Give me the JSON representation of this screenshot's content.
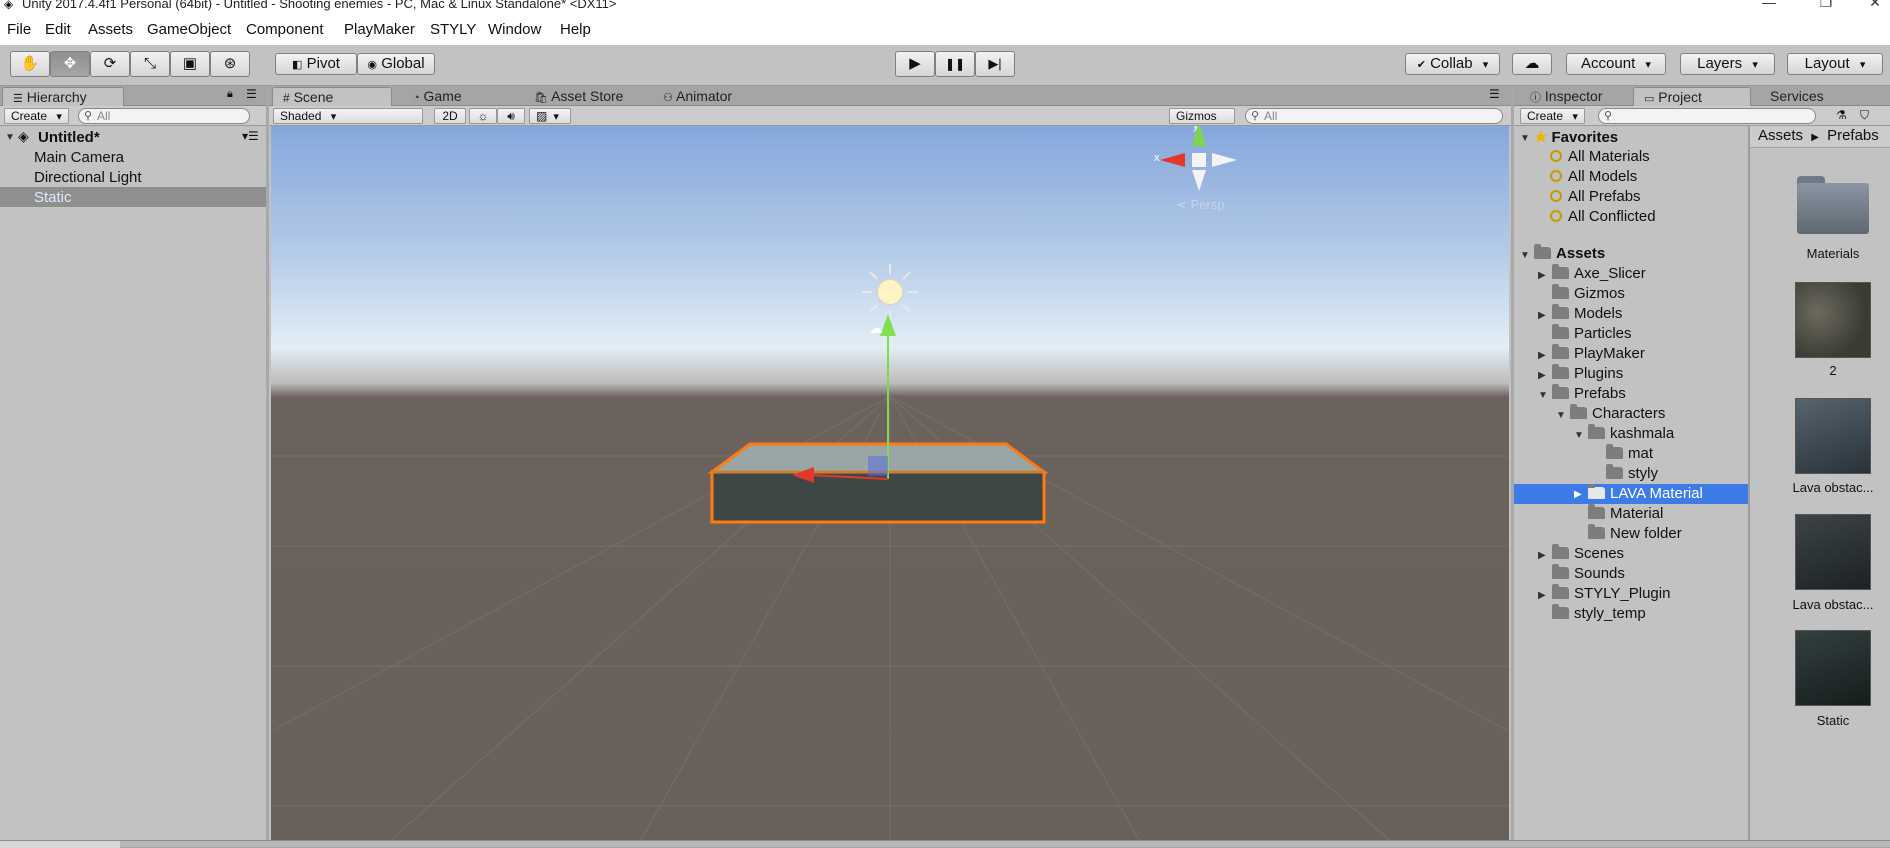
{
  "window": {
    "title": "Unity 2017.4.4f1 Personal (64bit) - Untitled - Shooting enemies - PC, Mac & Linux Standalone* <DX11>",
    "minimize": "—",
    "maximize": "❐",
    "close": "✕"
  },
  "menu": [
    "File",
    "Edit",
    "Assets",
    "GameObject",
    "Component",
    "PlayMaker",
    "STYLY",
    "Window",
    "Help"
  ],
  "toolbar": {
    "pivot": "Pivot",
    "global": "Global",
    "collab": "Collab",
    "account": "Account",
    "layers": "Layers",
    "layout": "Layout",
    "play_icon": "▶",
    "pause_icon": "❚❚",
    "step_icon": "▶|"
  },
  "hierarchy": {
    "tab": "Hierarchy",
    "create": "Create",
    "search_placeholder": "All",
    "scene_name": "Untitled*",
    "items": [
      "Main Camera",
      "Directional Light",
      "Static"
    ],
    "selected": "Static"
  },
  "scene_view": {
    "tabs": [
      "Scene",
      "Game",
      "Asset Store",
      "Animator"
    ],
    "shading": "Shaded",
    "mode_2d": "2D",
    "gizmos": "Gizmos",
    "search_placeholder": "All",
    "persp_label": "Persp",
    "axis_x": "x",
    "axis_y": "y"
  },
  "right_panel": {
    "tabs": [
      "Inspector",
      "Project",
      "Services"
    ],
    "active_tab": "Project",
    "create": "Create",
    "favorites": {
      "label": "Favorites",
      "items": [
        "All Materials",
        "All Models",
        "All Prefabs",
        "All Conflicted"
      ]
    },
    "assets": {
      "label": "Assets",
      "tree": [
        "Axe_Slicer",
        "Gizmos",
        "Models",
        "Particles",
        "PlayMaker",
        "Plugins",
        "Prefabs",
        "Characters",
        "kashmala",
        "mat",
        "styly",
        "LAVA Material",
        "Material",
        "New folder",
        "Scenes",
        "Sounds",
        "STYLY_Plugin",
        "styly_temp"
      ],
      "selected": "LAVA Material"
    },
    "breadcrumb": [
      "Assets",
      "Prefabs"
    ],
    "thumbnails": [
      "Materials",
      "2",
      "Lava obstac...",
      "Lava obstac...",
      "Static"
    ]
  },
  "colors": {
    "selection": "#3d7be6",
    "selected_hierarchy": "#8f8f8f",
    "outline": "#ff7a10"
  }
}
